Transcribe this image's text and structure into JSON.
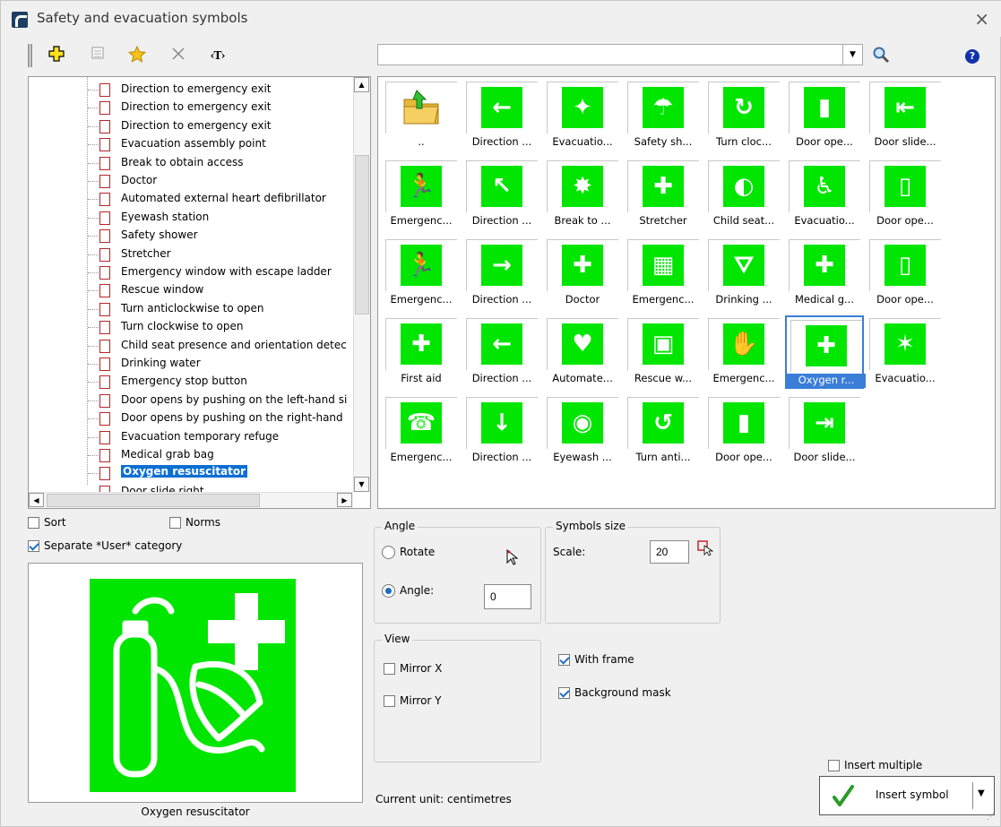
{
  "window": {
    "title": "Safety and evacuation symbols",
    "close_glyph": "×"
  },
  "toolbar": {
    "text_tool_label": "‹T›"
  },
  "search": {
    "value": "",
    "placeholder": ""
  },
  "tree": {
    "items": [
      "Direction to emergency exit",
      "Direction to emergency exit",
      "Direction to emergency exit",
      "Evacuation assembly point",
      "Break to obtain access",
      "Doctor",
      "Automated external heart defibrillator",
      "Eyewash station",
      "Safety shower",
      "Stretcher",
      "Emergency window with escape ladder",
      "Rescue window",
      "Turn anticlockwise to open",
      "Turn clockwise to open",
      "Child seat presence and orientation detec",
      "Drinking water",
      "Emergency stop button",
      "Door opens by pushing on the left-hand si",
      "Door opens by pushing on the right-hand",
      "Evacuation temporary refuge",
      "Medical grab bag",
      "Oxygen resuscitator",
      "Door slide right"
    ],
    "selected_index": 21
  },
  "gallery": {
    "cells": [
      {
        "caption": "..",
        "glyph": "folder"
      },
      {
        "caption": "Direction ...",
        "glyph": "←"
      },
      {
        "caption": "Evacuatio...",
        "glyph": "✦"
      },
      {
        "caption": "Safety sh...",
        "glyph": "☂"
      },
      {
        "caption": "Turn cloc...",
        "glyph": "↻"
      },
      {
        "caption": "Door ope...",
        "glyph": "▮"
      },
      {
        "caption": "Door slide...",
        "glyph": "⇤"
      },
      {
        "caption": "Emergenc...",
        "glyph": "🏃"
      },
      {
        "caption": "Direction ...",
        "glyph": "↖"
      },
      {
        "caption": "Break to ...",
        "glyph": "✸"
      },
      {
        "caption": "Stretcher",
        "glyph": "✚"
      },
      {
        "caption": "Child seat...",
        "glyph": "◐"
      },
      {
        "caption": "Evacuatio...",
        "glyph": "♿"
      },
      {
        "caption": "Door ope...",
        "glyph": "▯"
      },
      {
        "caption": "Emergenc...",
        "glyph": "🏃"
      },
      {
        "caption": "Direction ...",
        "glyph": "→"
      },
      {
        "caption": "Doctor",
        "glyph": "✚"
      },
      {
        "caption": "Emergenc...",
        "glyph": "▦"
      },
      {
        "caption": "Drinking ...",
        "glyph": "⛛"
      },
      {
        "caption": "Medical g...",
        "glyph": "✚"
      },
      {
        "caption": "Door ope...",
        "glyph": "▯"
      },
      {
        "caption": "First aid",
        "glyph": "✚"
      },
      {
        "caption": "Direction ...",
        "glyph": "←"
      },
      {
        "caption": "Automate...",
        "glyph": "♥"
      },
      {
        "caption": "Rescue w...",
        "glyph": "▣"
      },
      {
        "caption": "Emergenc...",
        "glyph": "✋"
      },
      {
        "caption": "Oxygen r...",
        "glyph": "✚"
      },
      {
        "caption": "Evacuatio...",
        "glyph": "✶"
      },
      {
        "caption": "Emergenc...",
        "glyph": "☎"
      },
      {
        "caption": "Direction ...",
        "glyph": "↓"
      },
      {
        "caption": "Eyewash ...",
        "glyph": "◉"
      },
      {
        "caption": "Turn anti...",
        "glyph": "↺"
      },
      {
        "caption": "Door ope...",
        "glyph": "▮"
      },
      {
        "caption": "Door slide...",
        "glyph": "⇥"
      }
    ],
    "selected_index": 26
  },
  "options": {
    "sort": {
      "label": "Sort",
      "checked": false
    },
    "norms": {
      "label": "Norms",
      "checked": false
    },
    "separate_user": {
      "label": "Separate *User* category",
      "checked": true
    }
  },
  "preview": {
    "caption": "Oxygen resuscitator"
  },
  "angle": {
    "legend": "Angle",
    "rotate_label": "Rotate",
    "angle_label": "Angle:",
    "angle_value": "0"
  },
  "size": {
    "legend": "Symbols size",
    "scale_label": "Scale:",
    "scale_value": "20"
  },
  "view": {
    "legend": "View",
    "mirror_x": "Mirror X",
    "mirror_y": "Mirror Y"
  },
  "frame": {
    "with_frame": "With frame",
    "background_mask": "Background mask"
  },
  "unit": "Current unit: centimetres",
  "insert": {
    "multiple_label": "Insert multiple",
    "button_label": "Insert symbol"
  },
  "colors": {
    "symbol_green": "#00e600",
    "selection_blue": "#0b6fd3"
  }
}
